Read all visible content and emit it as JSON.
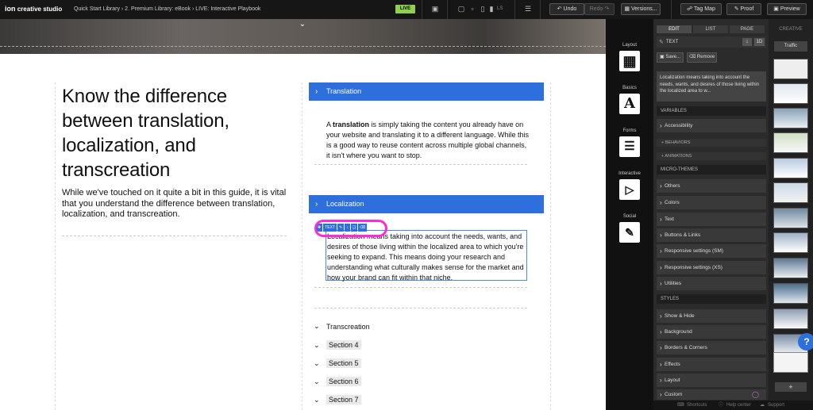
{
  "topbar": {
    "brand_logo": "ion",
    "brand_text": "creative studio",
    "breadcrumb": "Quick Start Library › 2. Premium Library: eBook › LIVE: Interactive Playbook",
    "live_badge": "LIVE",
    "device_ls": "LS",
    "undo": "Undo",
    "redo": "Redo",
    "versions": "Versions...",
    "tag_map": "Tag Map",
    "proof": "Proof",
    "preview": "Preview"
  },
  "page": {
    "heading": "Know the difference between translation, localization, and transcreation",
    "intro": "While we've touched on it quite a bit in this guide, it is vital that you understand the difference between translation, localization, and transcreation.",
    "accordions": {
      "translation": {
        "label": "Translation",
        "body_prefix": "A ",
        "body_bold": "translation",
        "body_rest": " is simply taking the content you already have on your website and translating it to a different language. While this is a good way to reuse content across multiple global channels, it isn't where you want to stop."
      },
      "localization": {
        "label": "Localization",
        "body": "Localization means taking into account the needs, wants, and desires of those living within the localized area to which you're seeking to expand. This means doing your research and understanding what culturally makes sense for the market and how your brand can fit within that niche."
      },
      "transcreation": {
        "label": "Transcreation"
      },
      "sections": [
        "Section 4",
        "Section 5",
        "Section 6",
        "Section 7"
      ]
    },
    "text_toolbar": {
      "label": "TEXT"
    }
  },
  "modules": [
    {
      "name": "Layout",
      "icon": "layout-icon"
    },
    {
      "name": "Basics",
      "icon": "text-a-icon"
    },
    {
      "name": "Forms",
      "icon": "form-icon"
    },
    {
      "name": "Interactive",
      "icon": "play-icon"
    },
    {
      "name": "Social",
      "icon": "chat-icon"
    }
  ],
  "props": {
    "tabs": [
      "EDIT",
      "LIST",
      "PAGE"
    ],
    "element_type": "TEXT",
    "badge": "1D",
    "save": "Save...",
    "remove": "Remove",
    "preview_text": "Localization means taking into account the needs, wants, and desires of those living within the localized area to w...",
    "variables_header": "VARIABLES",
    "accessibility": "Accessibility",
    "behaviors": "+ BEHAVIORS",
    "animations": "+ ANIMATIONS",
    "micro_header": "MICRO-THEMES",
    "micro_items": [
      "Others",
      "Colors",
      "Text",
      "Buttons & Links",
      "Responsive settings (SM)",
      "Responsive settings (XS)",
      "Utilities"
    ],
    "styles_header": "STYLES",
    "style_items": [
      "Show & Hide",
      "Background",
      "Borders & Corners",
      "Effects",
      "Layout",
      "Custom"
    ]
  },
  "strip": {
    "header": "CREATIVE",
    "traffic": "Traffic",
    "add": "+"
  },
  "footer": {
    "shortcuts": "Shortcuts",
    "help": "Help center",
    "support": "Support"
  },
  "help_button": "?"
}
